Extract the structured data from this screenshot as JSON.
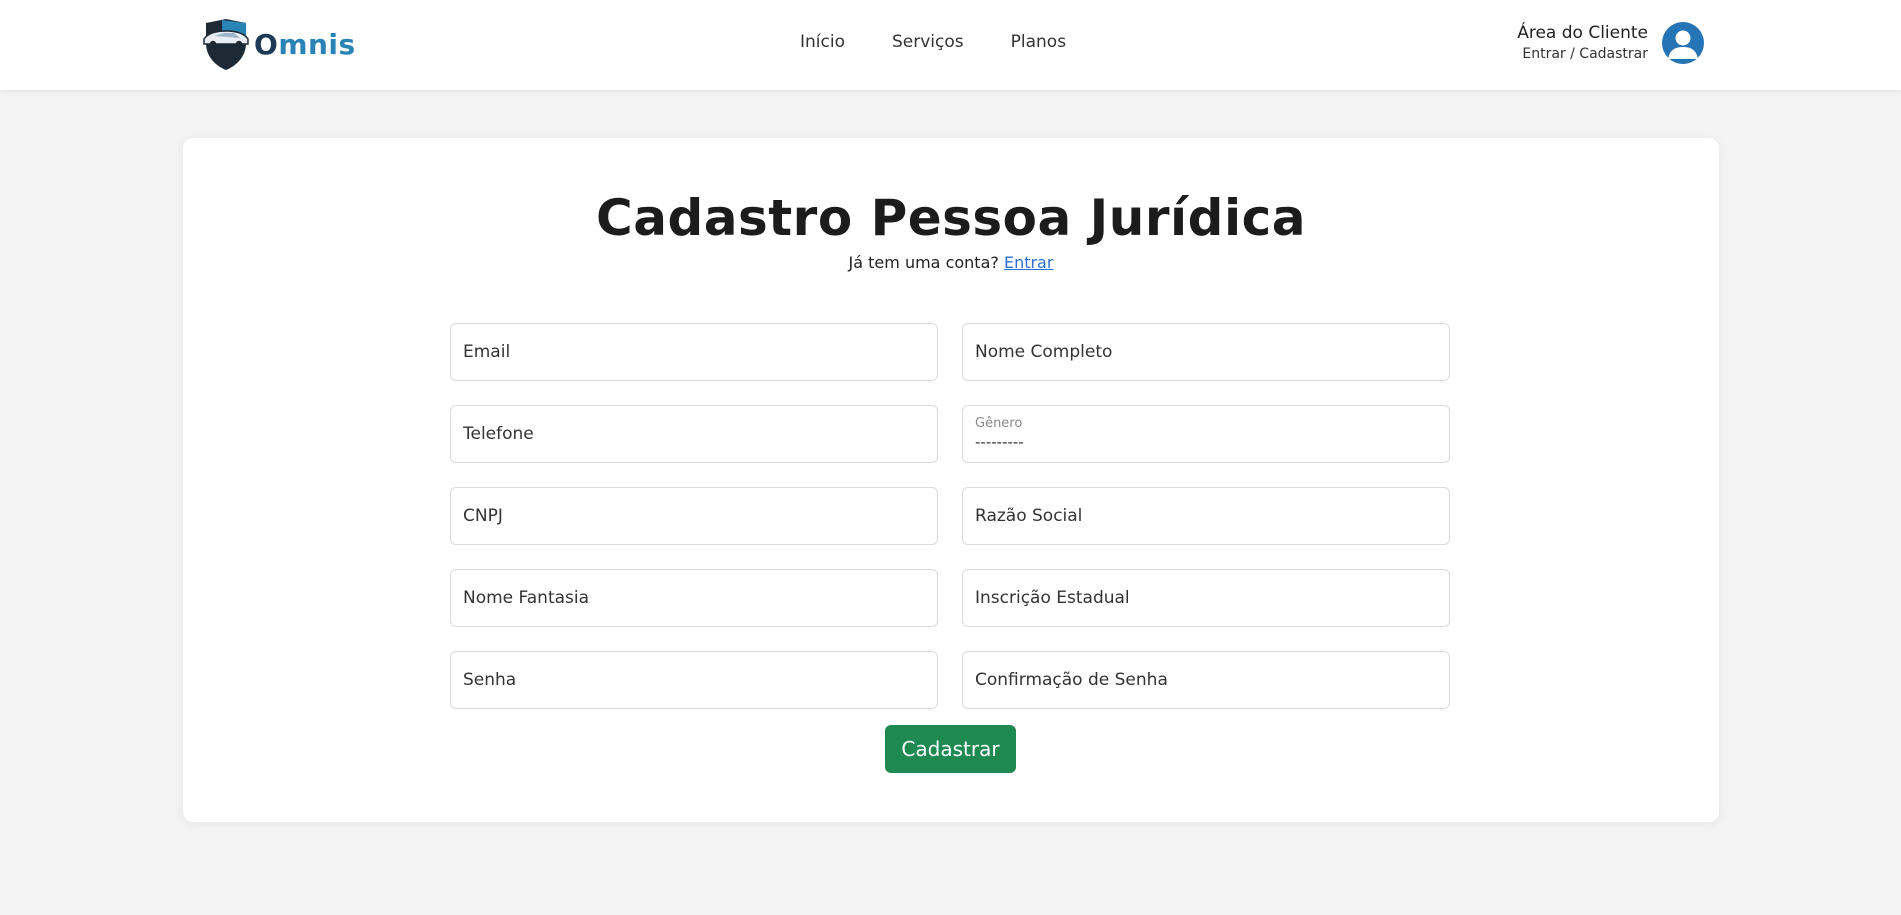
{
  "header": {
    "brand": {
      "first_letter": "O",
      "rest": "mnis",
      "logo_icon": "shield-car-logo"
    },
    "nav": [
      {
        "label": "Início"
      },
      {
        "label": "Serviços"
      },
      {
        "label": "Planos"
      }
    ],
    "client_area": {
      "title": "Área do Cliente",
      "subtitle": "Entrar / Cadastrar",
      "avatar_icon": "user-avatar-icon"
    }
  },
  "form": {
    "title": "Cadastro Pessoa Jurídica",
    "login_prompt": "Já tem uma conta?",
    "login_link": "Entrar",
    "fields": {
      "email": "Email",
      "nome_completo": "Nome Completo",
      "telefone": "Telefone",
      "genero_label": "Gênero",
      "genero_value": "---------",
      "cnpj": "CNPJ",
      "razao_social": "Razão Social",
      "nome_fantasia": "Nome Fantasia",
      "inscricao_estadual": "Inscrição Estadual",
      "senha": "Senha",
      "confirmacao_senha": "Confirmação de Senha"
    },
    "submit_label": "Cadastrar"
  },
  "colors": {
    "brand_dark": "#1e3a55",
    "brand_light": "#2a83b5",
    "primary_button": "#1e8a52",
    "link": "#2a6fd6",
    "avatar": "#2474b6",
    "page_background": "#f3f3f3"
  }
}
